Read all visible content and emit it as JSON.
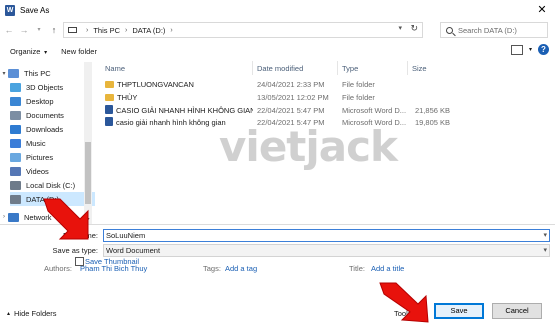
{
  "window": {
    "title": "Save As"
  },
  "address": {
    "crumbs": [
      "This PC",
      "DATA (D:)"
    ],
    "search_placeholder": "Search DATA (D:)"
  },
  "toolbar": {
    "organize_label": "Organize",
    "new_folder_label": "New folder"
  },
  "nav": {
    "items": [
      {
        "label": "This PC",
        "icon": "computer-icon",
        "color": "#5b8fd6"
      },
      {
        "label": "3D Objects",
        "icon": "cube-icon",
        "color": "#4aa3df"
      },
      {
        "label": "Desktop",
        "icon": "desktop-icon",
        "color": "#3a86d4"
      },
      {
        "label": "Documents",
        "icon": "documents-icon",
        "color": "#7c8ea3"
      },
      {
        "label": "Downloads",
        "icon": "downloads-icon",
        "color": "#2e7bd1"
      },
      {
        "label": "Music",
        "icon": "music-icon",
        "color": "#3b7dd8"
      },
      {
        "label": "Pictures",
        "icon": "pictures-icon",
        "color": "#6aa8e0"
      },
      {
        "label": "Videos",
        "icon": "videos-icon",
        "color": "#5577b5"
      },
      {
        "label": "Local Disk (C:)",
        "icon": "drive-icon",
        "color": "#6e7b8a"
      },
      {
        "label": "DATA (D:)",
        "icon": "drive-icon",
        "color": "#6e7b8a"
      },
      {
        "label": "Network",
        "icon": "network-icon",
        "color": "#3a79c7"
      }
    ]
  },
  "files": {
    "columns": {
      "name": "Name",
      "date": "Date modified",
      "type": "Type",
      "size": "Size"
    },
    "rows": [
      {
        "name": "THPTLUONGVANCAN",
        "date": "24/04/2021 2:33 PM",
        "type": "File folder",
        "size": "",
        "icon": "folder-icon"
      },
      {
        "name": "THÙY",
        "date": "13/05/2021 12:02 PM",
        "type": "File folder",
        "size": "",
        "icon": "folder-icon"
      },
      {
        "name": "CASIO GIẢI NHANH HÌNH KHÔNG GIAN...",
        "date": "22/04/2021 5:47 PM",
        "type": "Microsoft Word D...",
        "size": "21,856 KB",
        "icon": "word-doc-icon"
      },
      {
        "name": "casio giải nhanh hình không gian",
        "date": "22/04/2021 5:47 PM",
        "type": "Microsoft Word D...",
        "size": "19,805 KB",
        "icon": "word-doc-icon"
      }
    ]
  },
  "watermark": "vietjack",
  "form": {
    "file_name_label": "File name:",
    "file_name_value": "SoLuuNiem",
    "save_type_label": "Save as type:",
    "save_type_value": "Word Document",
    "authors_label": "Authors:",
    "authors_value": "Pham Thi Bich Thuy",
    "tags_label": "Tags:",
    "tags_value": "Add a tag",
    "title_label": "Title:",
    "title_value": "Add a title",
    "thumbnail_label": "Save Thumbnail"
  },
  "footer": {
    "hide_folders_label": "Hide Folders",
    "tools_label": "Tools",
    "save_label": "Save",
    "cancel_label": "Cancel"
  },
  "colors": {
    "accent": "#0078d7",
    "link": "#1a5fb4",
    "arrow": "#e8120c"
  }
}
